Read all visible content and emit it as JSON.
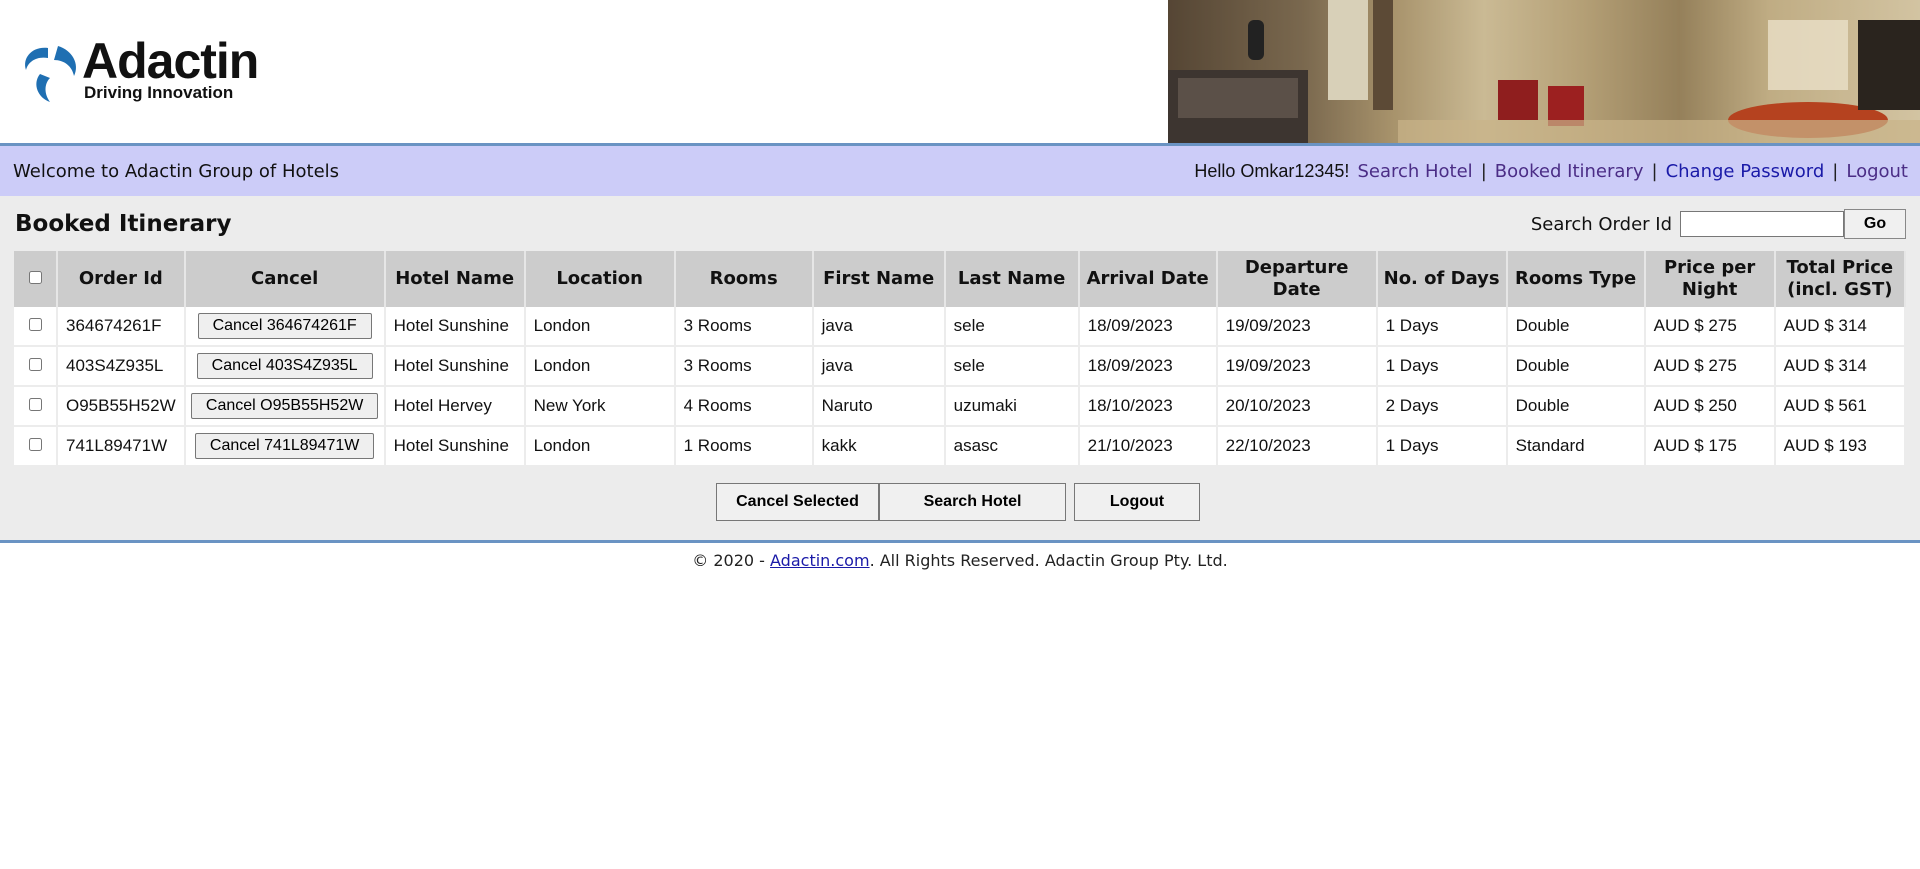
{
  "brand": {
    "name": "Adactin",
    "tagline": "Driving Innovation"
  },
  "welcome": {
    "text": "Welcome to Adactin Group of Hotels",
    "hello": "Hello Omkar12345!",
    "links": [
      "Search Hotel",
      "Booked Itinerary",
      "Change Password",
      "Logout"
    ]
  },
  "page": {
    "title": "Booked Itinerary",
    "search_label": "Search Order Id",
    "search_value": "",
    "go_label": "Go"
  },
  "table": {
    "headers": [
      "Order Id",
      "Cancel",
      "Hotel Name",
      "Location",
      "Rooms",
      "First Name",
      "Last Name",
      "Arrival Date",
      "Departure Date",
      "No. of Days",
      "Rooms Type",
      "Price per Night",
      "Total Price (incl. GST)"
    ],
    "rows": [
      {
        "order_id": "364674261F",
        "cancel": "Cancel 364674261F",
        "hotel": "Hotel Sunshine",
        "location": "London",
        "rooms": "3 Rooms",
        "first": "java",
        "last": "sele",
        "arrival": "18/09/2023",
        "departure": "19/09/2023",
        "days": "1 Days",
        "type": "Double",
        "ppn": "AUD $ 275",
        "total": "AUD $ 314"
      },
      {
        "order_id": "403S4Z935L",
        "cancel": "Cancel 403S4Z935L",
        "hotel": "Hotel Sunshine",
        "location": "London",
        "rooms": "3 Rooms",
        "first": "java",
        "last": "sele",
        "arrival": "18/09/2023",
        "departure": "19/09/2023",
        "days": "1 Days",
        "type": "Double",
        "ppn": "AUD $ 275",
        "total": "AUD $ 314"
      },
      {
        "order_id": "O95B55H52W",
        "cancel": "Cancel O95B55H52W",
        "hotel": "Hotel Hervey",
        "location": "New York",
        "rooms": "4 Rooms",
        "first": "Naruto",
        "last": "uzumaki",
        "arrival": "18/10/2023",
        "departure": "20/10/2023",
        "days": "2 Days",
        "type": "Double",
        "ppn": "AUD $ 250",
        "total": "AUD $ 561"
      },
      {
        "order_id": "741L89471W",
        "cancel": "Cancel 741L89471W",
        "hotel": "Hotel Sunshine",
        "location": "London",
        "rooms": "1 Rooms",
        "first": "kakk",
        "last": "asasc",
        "arrival": "21/10/2023",
        "departure": "22/10/2023",
        "days": "1 Days",
        "type": "Standard",
        "ppn": "AUD $ 175",
        "total": "AUD $ 193"
      }
    ]
  },
  "actions": {
    "cancel_selected": "Cancel Selected",
    "search_hotel": "Search Hotel",
    "logout": "Logout"
  },
  "footer": {
    "prefix": "© 2020 - ",
    "link": "Adactin.com",
    "suffix": ". All Rights Reserved. Adactin Group Pty. Ltd."
  },
  "colors": {
    "welcome_bar": "#ccccf8",
    "accent_border": "#6a93c3",
    "link": "#4b2d86"
  }
}
